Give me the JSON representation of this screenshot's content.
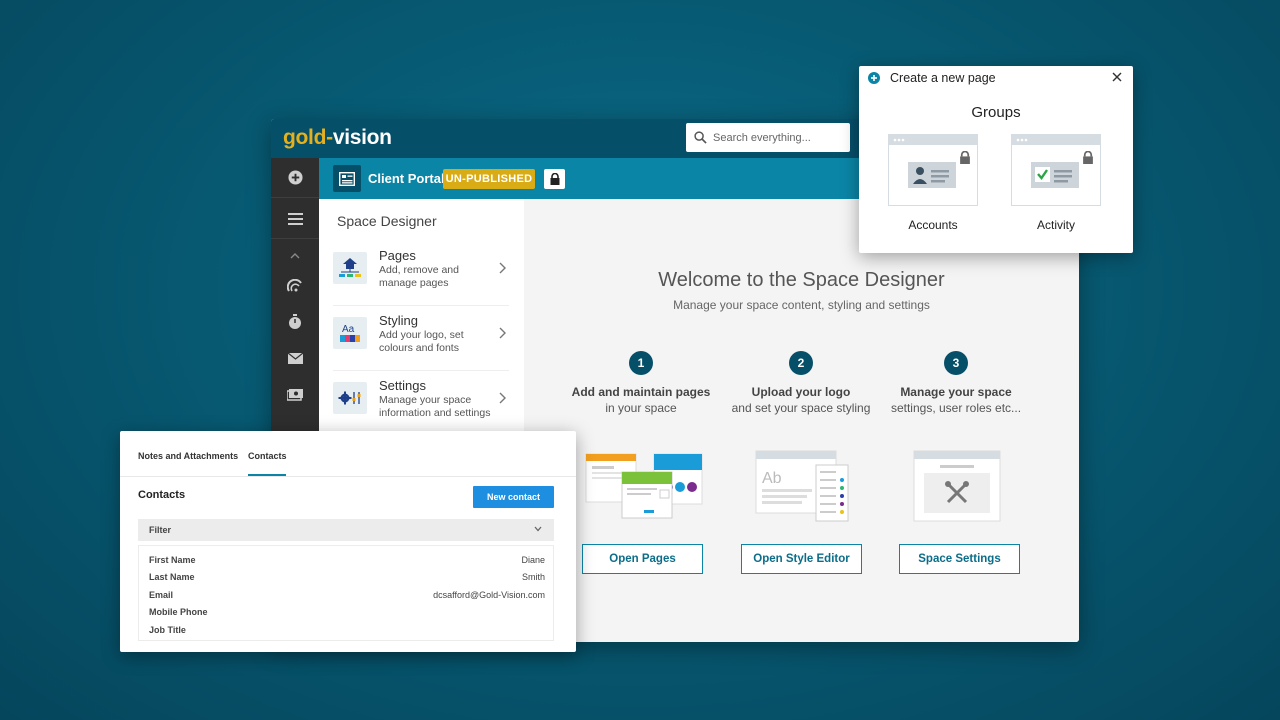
{
  "app": {
    "logo_gold": "gold",
    "logo_dash": "-",
    "logo_vision": "vision",
    "search_placeholder": "Search everything...",
    "portal_name": "Client Portal",
    "status_badge": "UN-PUBLISHED"
  },
  "nav": {
    "icons": [
      "plus-circle-icon",
      "menu-icon",
      "chevron-up-icon",
      "dashboard-gauge-icon",
      "stopwatch-icon",
      "mail-icon",
      "money-icon"
    ]
  },
  "side_panel": {
    "title": "Space Designer",
    "items": [
      {
        "name": "Pages",
        "desc": "Add, remove and manage pages"
      },
      {
        "name": "Styling",
        "desc": "Add your logo, set colours and fonts"
      },
      {
        "name": "Settings",
        "desc": "Manage your space information and settings"
      }
    ]
  },
  "main": {
    "title": "Welcome to the Space Designer",
    "subtitle": "Manage your space content, styling and settings",
    "steps": [
      {
        "num": "1",
        "bold": "Add and maintain pages",
        "rest": "in your space",
        "button": "Open Pages"
      },
      {
        "num": "2",
        "bold": "Upload your logo",
        "rest": "and set your space styling",
        "button": "Open Style Editor"
      },
      {
        "num": "3",
        "bold": "Manage your space",
        "rest": "settings, user roles etc...",
        "button": "Space Settings"
      }
    ]
  },
  "popup": {
    "title": "Create a new page",
    "group_heading": "Groups",
    "cards": [
      {
        "label": "Accounts"
      },
      {
        "label": "Activity"
      }
    ]
  },
  "contacts": {
    "tabs": [
      "Notes and Attachments",
      "Contacts"
    ],
    "active_tab": "Contacts",
    "heading": "Contacts",
    "new_button": "New contact",
    "filter_label": "Filter",
    "fields": [
      {
        "key": "First Name",
        "value": "Diane"
      },
      {
        "key": "Last Name",
        "value": "Smith"
      },
      {
        "key": "Email",
        "value": "dcsafford@Gold-Vision.com"
      },
      {
        "key": "Mobile Phone",
        "value": ""
      },
      {
        "key": "Job Title",
        "value": ""
      }
    ]
  },
  "colors": {
    "background": "#075a73",
    "topbar": "#064f69",
    "subbar": "#0b85a6",
    "badge": "#d9ac16",
    "logo_gold": "#e3b11f",
    "primary_button": "#1e8fe0"
  }
}
